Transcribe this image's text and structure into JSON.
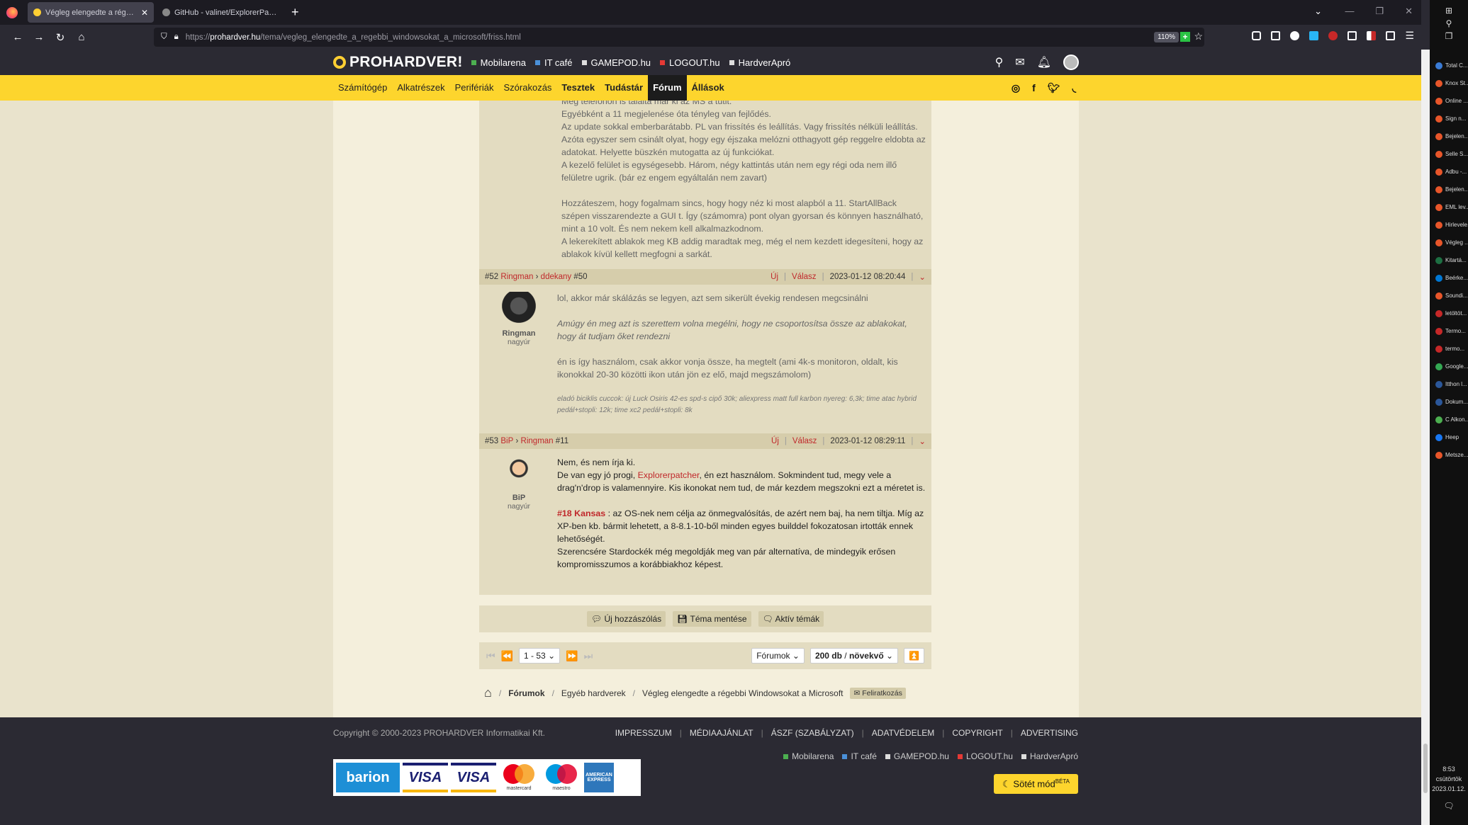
{
  "browser": {
    "tabs": [
      {
        "title": "Végleg elengedte a régebbi Wi",
        "active": true,
        "favicon_color": "#ffcf33"
      },
      {
        "title": "GitHub - valinet/ExplorerPatche",
        "active": false,
        "favicon_color": "#888888"
      }
    ],
    "url_proto": "https://",
    "url_domain": "prohardver.hu",
    "url_path": "/tema/vegleg_elengedte_a_regebbi_windowsokat_a_microsoft/friss.html",
    "zoom": "110%"
  },
  "site": {
    "logo": "PROHARDVER!",
    "top_links": [
      {
        "label": "Mobilarena",
        "color": "#4caf50"
      },
      {
        "label": "IT café",
        "color": "#4a90d9"
      },
      {
        "label": "GAMEPOD.hu",
        "color": "#dddddd"
      },
      {
        "label": "LOGOUT.hu",
        "color": "#e53935"
      },
      {
        "label": "HardverApró",
        "color": "#dddddd"
      }
    ],
    "nav": [
      "Számítógép",
      "Alkatrészek",
      "Perifériák",
      "Szórakozás",
      "Tesztek",
      "Tudástár",
      "Fórum",
      "Állások"
    ],
    "accent": "#fdd52d"
  },
  "posts": {
    "p51_lines": [
      "Meg telefonon is találta már ki az MS a tutit.",
      "Egyébként a 11 megjelenése óta tényleg van fejlődés.",
      "Az update sokkal emberbarátabb. PL van frissítés és leállítás. Vagy frissítés nélküli leállítás.",
      "Azóta egyszer sem csinált olyat, hogy egy éjszaka melózni otthagyott gép reggelre eldobta az adatokat. Helyette büszkén mutogatta az új funkciókat.",
      "A kezelő felület is egységesebb. Három, négy kattintás után nem egy régi oda nem illő felületre ugrik. (bár ez engem egyáltalán nem zavart)"
    ],
    "p51_lines2": [
      "Hozzáteszem, hogy fogalmam sincs, hogy hogy néz ki most alapból a 11. StartAllBack szépen visszarendezte a GUI t. Így (számomra) pont olyan gyorsan és könnyen használható, mint a 10 volt. És nem nekem kell alkalmazkodnom.",
      "A lekerekített ablakok meg KB addig maradtak meg, még el nem kezdett idegesíteni, hogy az ablakok kívül kellett megfogni a sarkát."
    ],
    "p52": {
      "num": "#52",
      "author": "Ringman",
      "reply_to": "ddekany",
      "reply_num": "#50",
      "new": "Új",
      "reply": "Válasz",
      "date": "2023-01-12 08:20:44",
      "rank": "nagyúr",
      "text1": "lol, akkor már skálázás se legyen, azt sem sikerült évekig rendesen megcsinálni",
      "quote": "Amúgy én meg azt is szerettem volna megélni, hogy ne csoportosítsa össze az ablakokat, hogy át tudjam őket rendezni",
      "text2": "én is így használom, csak akkor vonja össze, ha megtelt (ami 4k-s monitoron, oldalt, kis ikonokkal 20-30 közötti ikon után jön ez elő, majd megszámolom)",
      "sig": "eladó biciklis cuccok: új Luck Osiris 42-es spd-s cipő 30k; aliexpress matt full karbon nyereg: 6,3k; time atac hybrid pedál+stopli: 12k; time xc2 pedál+stopli: 8k"
    },
    "p53": {
      "num": "#53",
      "author": "BiP",
      "reply_to": "Ringman",
      "reply_num": "#11",
      "new": "Új",
      "reply": "Válasz",
      "date": "2023-01-12 08:29:11",
      "rank": "nagyúr",
      "l1": "Nem, és nem írja ki.",
      "l2a": "De van egy jó progi, ",
      "l2link": "Explorerpatcher",
      "l2b": ", én ezt használom. Sokmindent tud, megy vele a drag'n'drop is valamennyire. Kis ikonokat nem tud, de már kezdem megszokni ezt a méretet is.",
      "ref": "#18 Kansas",
      "l3": " : az OS-nek nem célja az önmegvalósítás, de azért nem baj, ha nem tiltja. Míg az XP-ben kb. bármit lehetett, a 8-8.1-10-ből minden egyes builddel fokozatosan irtották ennek lehetőségét.",
      "l4": "Szerencsére Stardockék még megoldják meg van pár alternatíva, de mindegyik erősen kompromisszumos a korábbiakhoz képest."
    }
  },
  "actions": {
    "new_post": "Új hozzászólás",
    "save_topic": "Téma mentése",
    "active_topics": "Aktív témák"
  },
  "pager": {
    "range": "1 - 53",
    "scope": "Fórumok",
    "per_page": "200 db",
    "order": "növekvő"
  },
  "breadcrumb": {
    "forums": "Fórumok",
    "category": "Egyéb hardverek",
    "topic": "Végleg elengedte a régebbi Windowsokat a Microsoft",
    "subscribe": "Feliratkozás"
  },
  "footer": {
    "copyright": "Copyright © 2000-2023 PROHARDVER Informatikai Kft.",
    "links": [
      "IMPRESSZUM",
      "MÉDIAAJÁNLAT",
      "ÁSZF (SZABÁLYZAT)",
      "ADATVÉDELEM",
      "COPYRIGHT",
      "ADVERTISING"
    ],
    "dark_mode": "Sötét mód",
    "beta": "BÉTA",
    "payments": {
      "barion": "barion",
      "visa": "VISA",
      "visa2": "VISA",
      "mastercard": "mastercard",
      "maestro": "maestro",
      "amex": "AMERICAN EXPRESS"
    }
  },
  "taskbar": {
    "items": [
      {
        "label": "Total C...",
        "color": "#3a7bd5"
      },
      {
        "label": "Knox St...",
        "color": "#e8562a"
      },
      {
        "label": "Online ...",
        "color": "#e8562a"
      },
      {
        "label": "Sign n...",
        "color": "#e8562a"
      },
      {
        "label": "Bejelen...",
        "color": "#e8562a"
      },
      {
        "label": "Selle S...",
        "color": "#e8562a"
      },
      {
        "label": "Adbu -...",
        "color": "#e8562a"
      },
      {
        "label": "Bejelen...",
        "color": "#e8562a"
      },
      {
        "label": "EML lev...",
        "color": "#e8562a"
      },
      {
        "label": "Hirlevele...",
        "color": "#e8562a"
      },
      {
        "label": "Végleg ...",
        "color": "#e8562a"
      },
      {
        "label": "Kitartá...",
        "color": "#1d6f42"
      },
      {
        "label": "Beérke...",
        "color": "#0078d4"
      },
      {
        "label": "Soundi...",
        "color": "#e8562a"
      },
      {
        "label": "letöltöt...",
        "color": "#c62828"
      },
      {
        "label": "Termo...",
        "color": "#c62828"
      },
      {
        "label": "termo...",
        "color": "#c62828"
      },
      {
        "label": "Google...",
        "color": "#34a853"
      },
      {
        "label": "Itthon l...",
        "color": "#2b579a"
      },
      {
        "label": "Dokum...",
        "color": "#2b579a"
      },
      {
        "label": "C Alkon...",
        "color": "#4caf50"
      },
      {
        "label": "Heep",
        "color": "#1877f2"
      },
      {
        "label": "Metsze...",
        "color": "#e8562a"
      }
    ],
    "time": "8:53",
    "day": "csütörtök",
    "date": "2023.01.12."
  }
}
